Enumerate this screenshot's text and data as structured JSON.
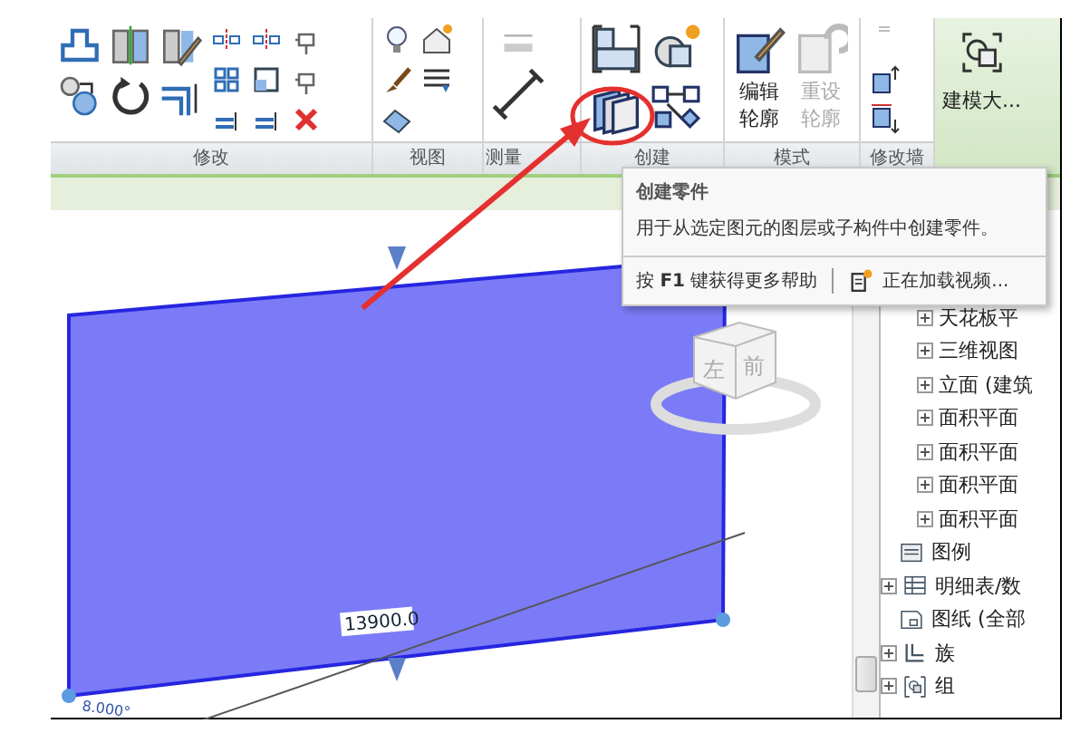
{
  "ribbon": {
    "panels": [
      {
        "label": "修改"
      },
      {
        "label": "视图"
      },
      {
        "label": "测量"
      },
      {
        "label": "创建"
      },
      {
        "label": "模式"
      },
      {
        "label": "修改墙"
      }
    ],
    "mode_buttons": [
      {
        "lines": [
          "编辑",
          "轮廓"
        ],
        "disabled": false
      },
      {
        "lines": [
          "重设",
          "轮廓"
        ],
        "disabled": true
      }
    ],
    "big_button": {
      "label": "建模大..."
    }
  },
  "tooltip": {
    "title": "创建零件",
    "description": "用于从选定图元的图层或子构件中创建零件。",
    "help": "按 **F1** 键获得更多帮助",
    "video": "正在加载视频..."
  },
  "view": {
    "dimension": "13900.0",
    "angle": "8.000°",
    "viewcube": {
      "left": "左",
      "front": "前"
    }
  },
  "browser": {
    "views": [
      {
        "label": "天花板平",
        "expandable": true
      },
      {
        "label": "三维视图",
        "expandable": true
      },
      {
        "label": "立面 (建筑",
        "expandable": true
      },
      {
        "label": "面积平面",
        "expandable": true
      },
      {
        "label": "面积平面",
        "expandable": true
      },
      {
        "label": "面积平面",
        "expandable": true
      },
      {
        "label": "面积平面",
        "expandable": true
      }
    ],
    "items": [
      {
        "label": "图例",
        "kind": "legend",
        "expandable": false
      },
      {
        "label": "明细表/数",
        "kind": "schedule",
        "expandable": true
      },
      {
        "label": "图纸 (全部",
        "kind": "sheet",
        "expandable": false
      },
      {
        "label": "族",
        "kind": "family",
        "expandable": true
      },
      {
        "label": "组",
        "kind": "group",
        "expandable": true
      }
    ]
  }
}
